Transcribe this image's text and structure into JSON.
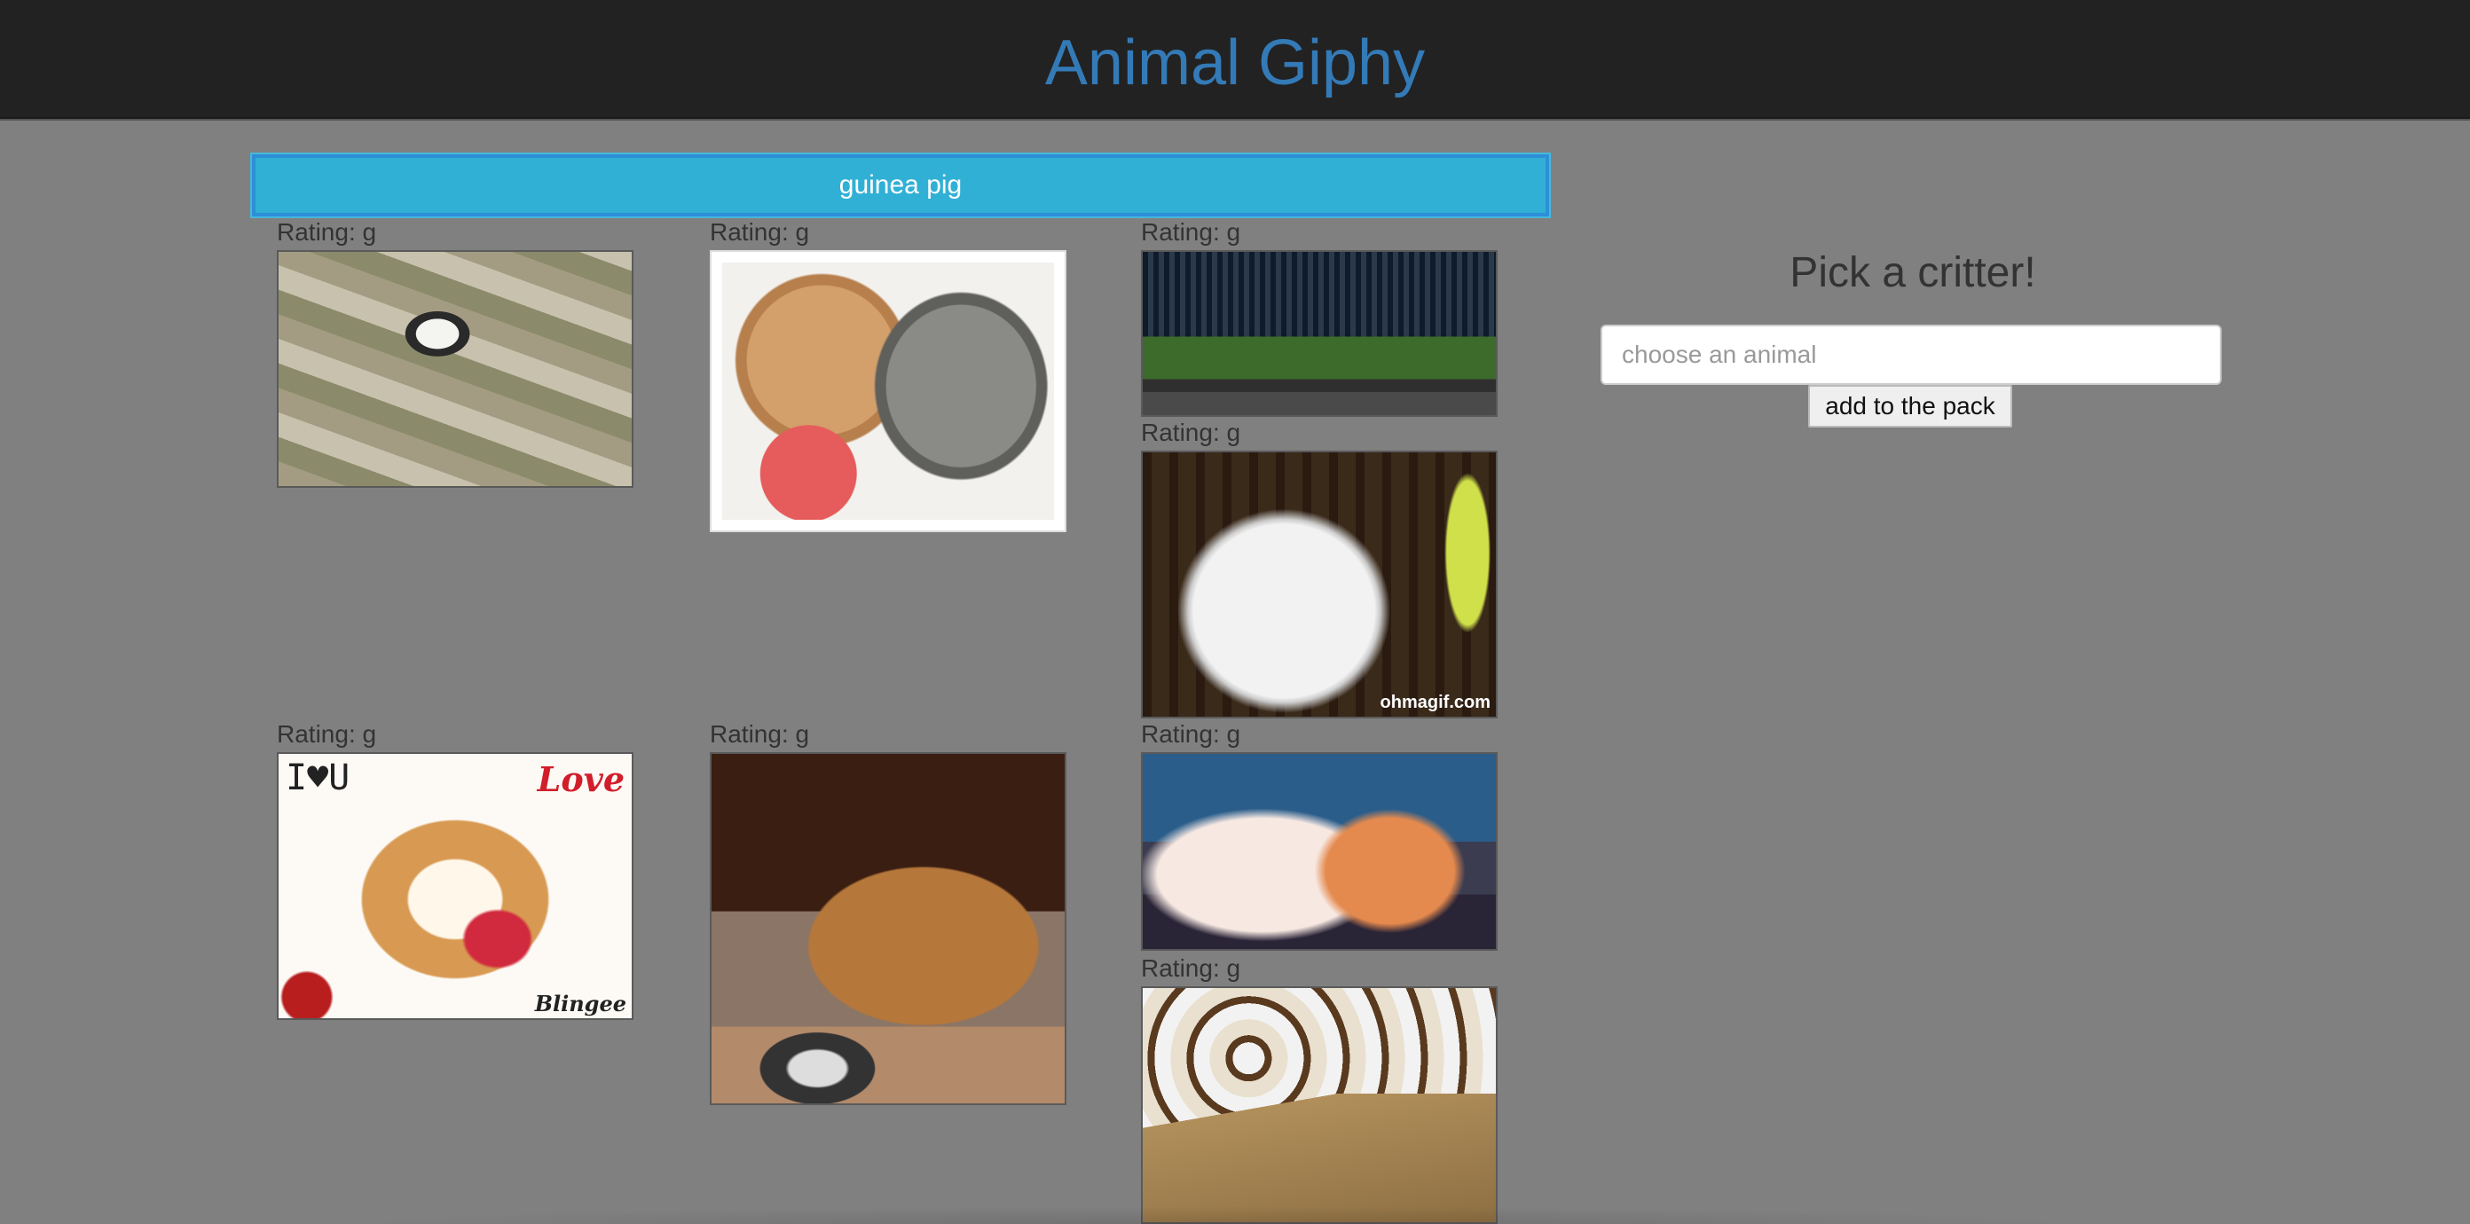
{
  "header": {
    "title": "Animal Giphy"
  },
  "buttons": [
    {
      "label": "guinea pig"
    }
  ],
  "gifs": [
    {
      "rating": "Rating: g"
    },
    {
      "rating": "Rating: g"
    },
    {
      "rating": "Rating: g"
    },
    {
      "rating": "Rating: g",
      "watermark": "ohmagif.com"
    },
    {
      "rating": "Rating: g",
      "overlay_left": "I♥U",
      "overlay_right": "Love",
      "brand": "Blingee"
    },
    {
      "rating": "Rating: g"
    },
    {
      "rating": "Rating: g"
    },
    {
      "rating": "Rating: g"
    }
  ],
  "form": {
    "title": "Pick a critter!",
    "input_placeholder": "choose an animal",
    "input_value": "",
    "submit_label": "add to the pack"
  },
  "colors": {
    "header_bg": "#222222",
    "title": "#337ab7",
    "page_bg": "#808080",
    "animal_button": "#31b0d5"
  }
}
